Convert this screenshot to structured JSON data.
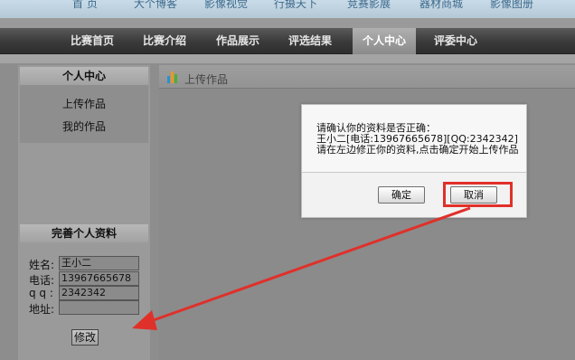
{
  "top_nav": [
    "首 页",
    "大个博客",
    "影像视觉",
    "行摄天下",
    "竞赛影展",
    "器材商城",
    "影像图册"
  ],
  "main_nav": {
    "items": [
      "比赛首页",
      "比赛介绍",
      "作品展示",
      "评选结果",
      "个人中心",
      "评委中心"
    ],
    "active": "个人中心"
  },
  "sidebar": {
    "title": "个人中心",
    "links": [
      "上传作品",
      "我的作品"
    ],
    "profile_title": "完善个人资料",
    "form": {
      "name_label": "姓名:",
      "name_value": "王小二",
      "phone_label": "电话:",
      "phone_value": "13967665678",
      "qq_label": "q q :",
      "qq_value": "2342342",
      "address_label": "地址:",
      "address_value": ""
    },
    "edit_button": "修改"
  },
  "content": {
    "title": "上传作品"
  },
  "dialog": {
    "line1": "请确认你的资料是否正确：",
    "line2": "王小二[电话:13967665678][QQ:2342342]",
    "line3": "请在左边修正你的资料,点击确定开始上传作品",
    "confirm": "确定",
    "cancel": "取消"
  },
  "colors": {
    "annotation": "#e0302a",
    "bar_icon": [
      "#2d8fd6",
      "#e89a1c",
      "#4caf35"
    ]
  }
}
